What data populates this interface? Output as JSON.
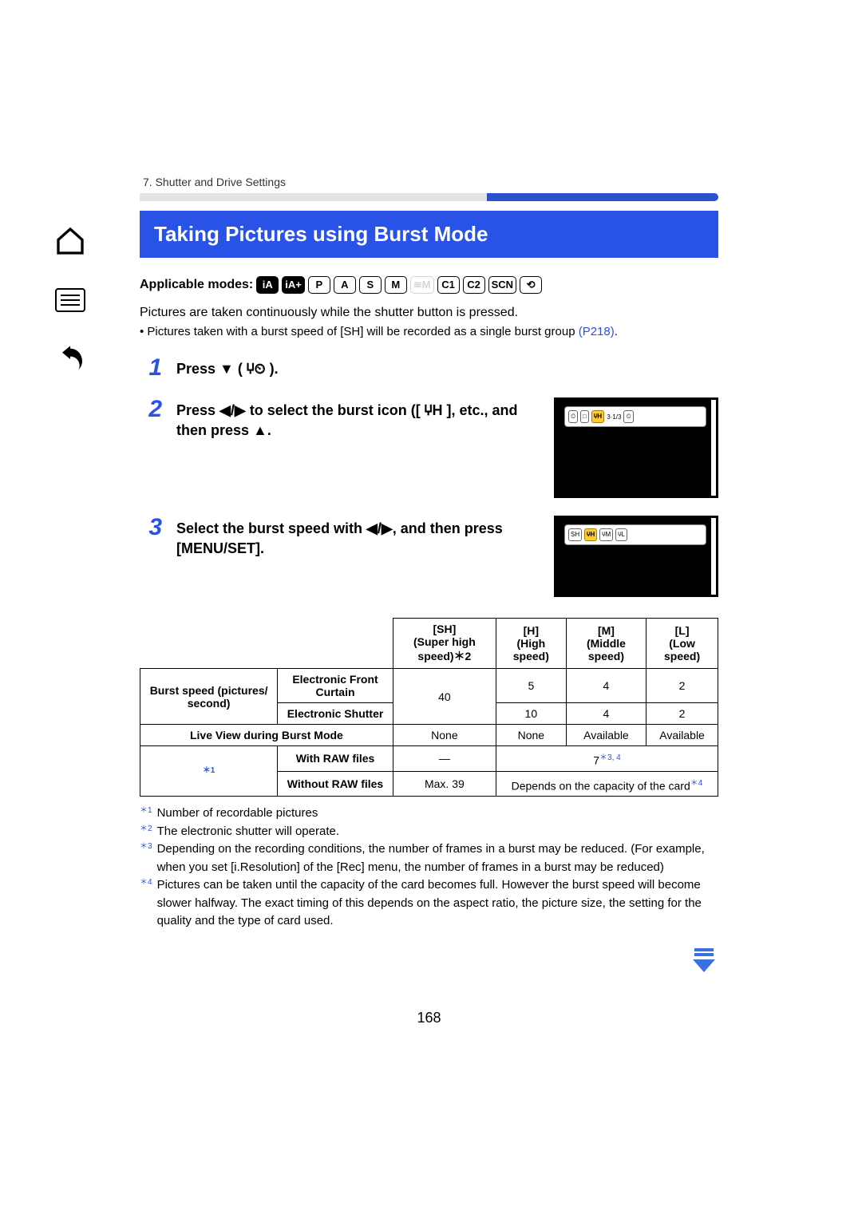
{
  "breadcrumb": "7. Shutter and Drive Settings",
  "title": "Taking Pictures using Burst Mode",
  "applicable_label": "Applicable modes:",
  "modes": [
    "iA",
    "iA+",
    "P",
    "A",
    "S",
    "M",
    "≋M",
    "C1",
    "C2",
    "SCN",
    "⟲"
  ],
  "intro": "Pictures are taken continuously while the shutter button is pressed.",
  "intro_sub_pre": "• Pictures taken with a burst speed of [SH] will be recorded as a single burst group ",
  "intro_sub_link": "(P218)",
  "intro_sub_post": ".",
  "steps": {
    "s1": {
      "num": "1",
      "text": "Press ▼ ( 🝘⏲ )."
    },
    "s2": {
      "num": "2",
      "text": "Press ◀/▶ to select the burst icon ([ 🝘H ], etc., and then press ▲."
    },
    "s3": {
      "num": "3",
      "text": "Select the burst speed with ◀/▶, and then press [MENU/SET]."
    }
  },
  "panel1": {
    "a": "⏲",
    "b": "□",
    "c": "🝘H",
    "d": "3·1/3",
    "e": "⏲"
  },
  "panel2": {
    "a": "SH",
    "b": "🝘H",
    "c": "🝘M",
    "d": "🝘L"
  },
  "table": {
    "headers": {
      "sh": "[SH]\n(Super high speed)",
      "sh_sup": "＊2",
      "h": "[H]\n(High speed)",
      "m": "[M]\n(Middle speed)",
      "l": "[L]\n(Low speed)"
    },
    "rows": {
      "burst_label": "Burst speed (pictures/ second)",
      "efc": "Electronic Front Curtain",
      "es": "Electronic Shutter",
      "live": "Live View during Burst Mode",
      "star1": "＊1",
      "withraw": "With RAW files",
      "withoutraw": "Without RAW files"
    },
    "vals": {
      "sh_efc": "40",
      "h_efc": "5",
      "m_efc": "4",
      "l_efc": "2",
      "h_es": "10",
      "m_es": "4",
      "l_es": "2",
      "live_sh": "None",
      "live_h": "None",
      "live_m": "Available",
      "live_l": "Available",
      "raw_sh": "—",
      "raw_hml": "7",
      "raw_sup": "＊3, 4",
      "noraw_sh": "Max. 39",
      "noraw_hml": "Depends on the capacity of the card",
      "noraw_sup": "＊4"
    }
  },
  "notes": {
    "n1": {
      "lbl": "＊1",
      "txt": "Number of recordable pictures"
    },
    "n2": {
      "lbl": "＊2",
      "txt": "The electronic shutter will operate."
    },
    "n3": {
      "lbl": "＊3",
      "txt": "Depending on the recording conditions, the number of frames in a burst may be reduced. (For example, when you set [i.Resolution] of the [Rec] menu, the number of frames in a burst may be reduced)"
    },
    "n4": {
      "lbl": "＊4",
      "txt": "Pictures can be taken until the capacity of the card becomes full. However the burst speed will become slower halfway. The exact timing of this depends on the aspect ratio, the picture size, the setting for the quality and the type of card used."
    }
  },
  "page_number": "168"
}
